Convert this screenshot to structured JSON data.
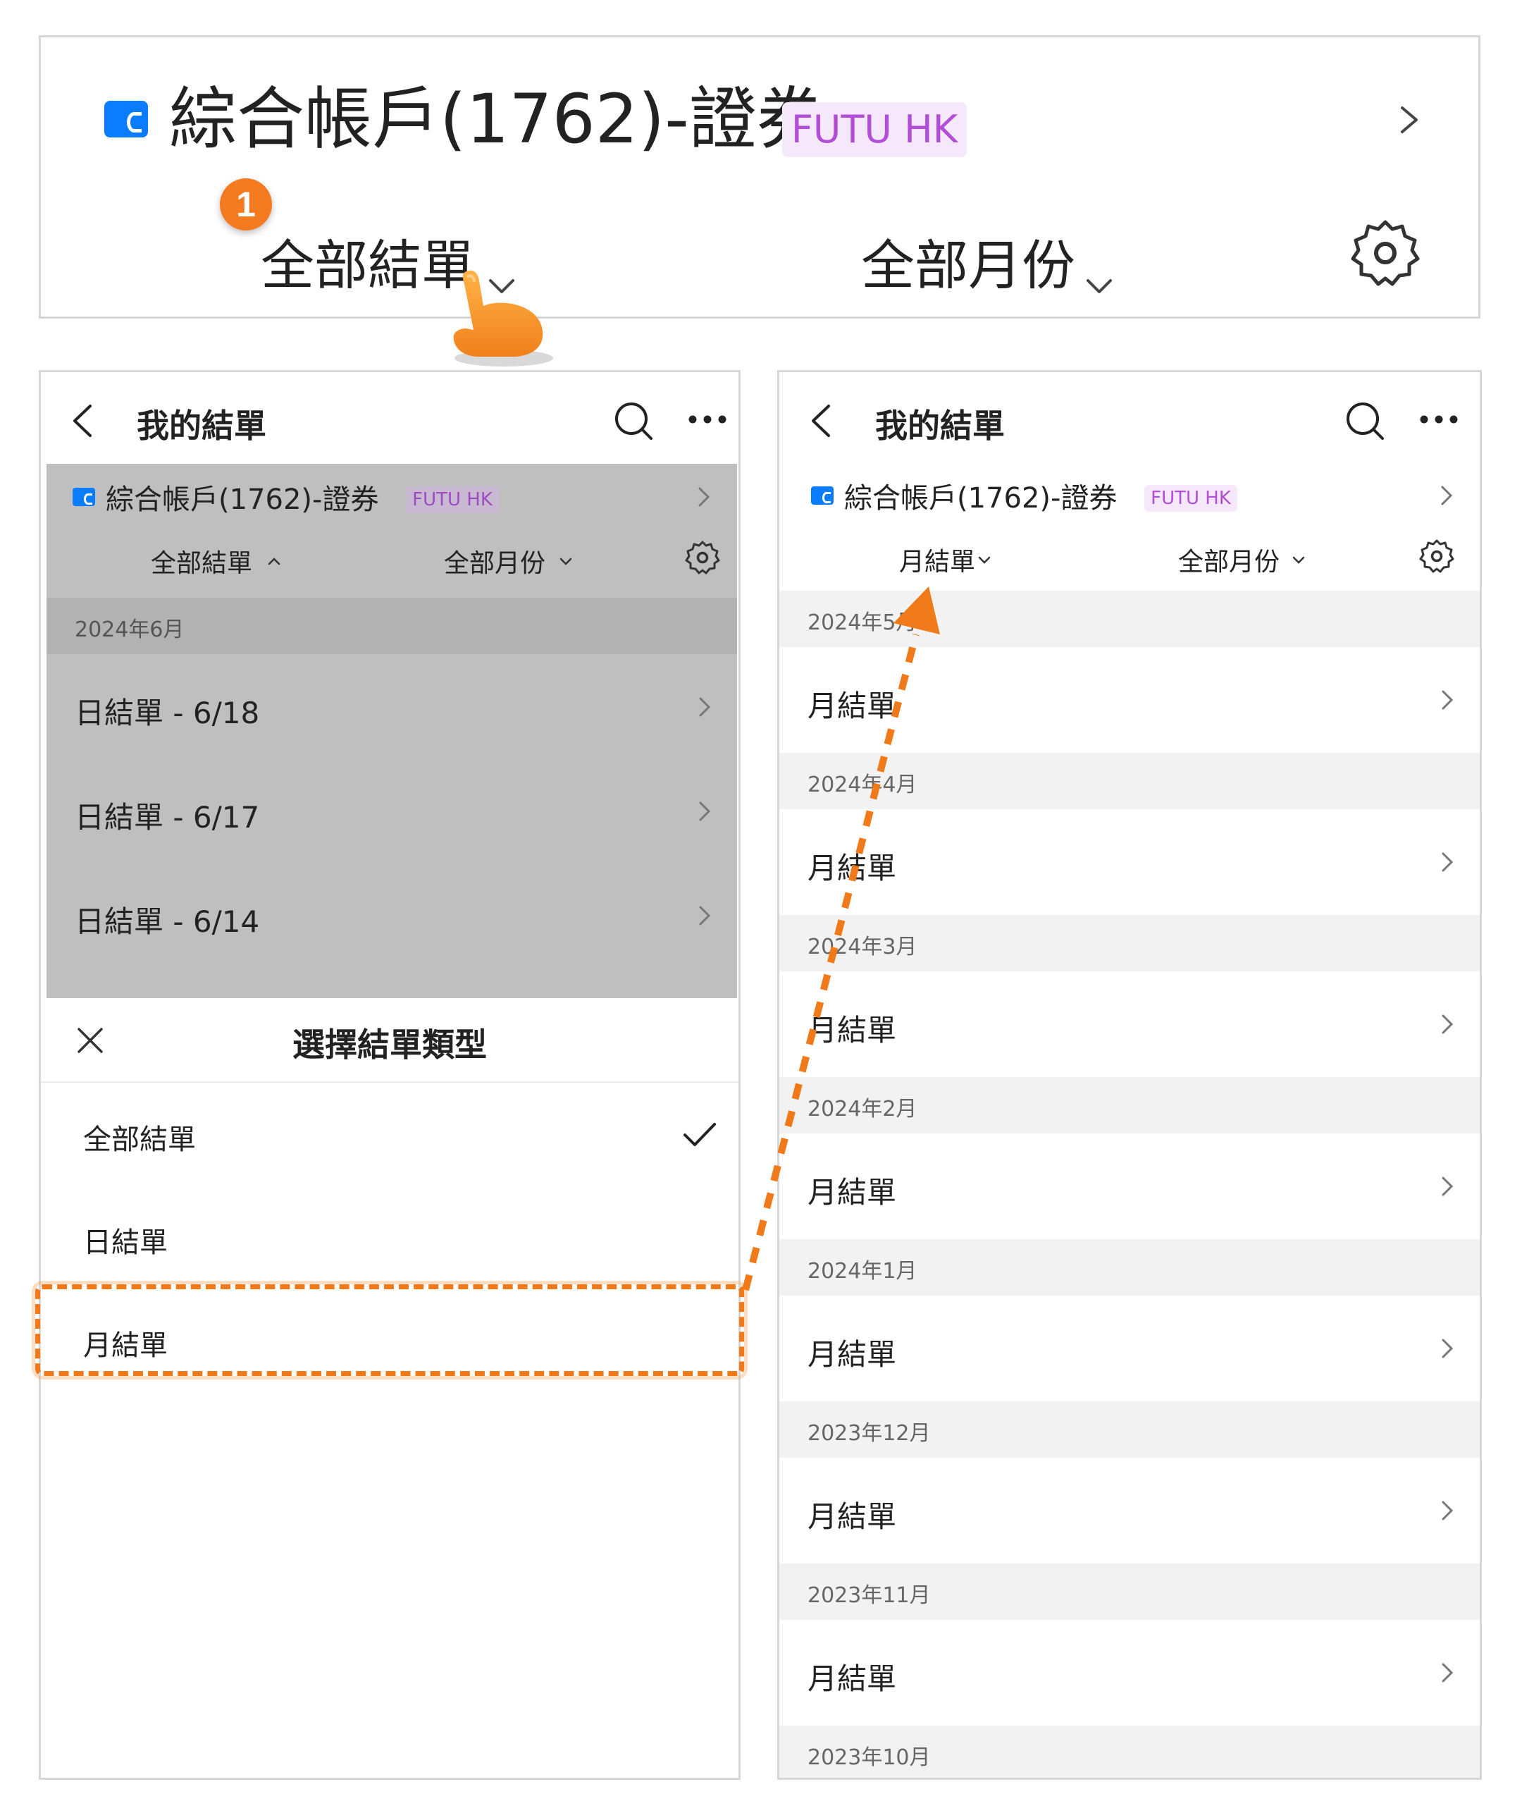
{
  "top": {
    "account": "綜合帳戶(1762)-證券",
    "badge": "FUTU HK",
    "filter_type": "全部結單",
    "filter_month": "全部月份",
    "step_number": "1"
  },
  "left_screen": {
    "nav_title": "我的結單",
    "account": "綜合帳戶(1762)-證券",
    "badge": "FUTU HK",
    "filter_type": "全部結單",
    "filter_month": "全部月份",
    "month_heading": "2024年6月",
    "statements": [
      "日結單 - 6/18",
      "日結單 - 6/17",
      "日結單 - 6/14"
    ],
    "sheet": {
      "title": "選擇結單類型",
      "options": [
        "全部結單",
        "日結單",
        "月結單"
      ],
      "selected_index": 0
    }
  },
  "right_screen": {
    "nav_title": "我的結單",
    "account": "綜合帳戶(1762)-證券",
    "badge": "FUTU HK",
    "filter_type": "月結單",
    "filter_month": "全部月份",
    "groups": [
      {
        "month": "2024年5月",
        "item": "月結單"
      },
      {
        "month": "2024年4月",
        "item": "月結單"
      },
      {
        "month": "2024年3月",
        "item": "月結單"
      },
      {
        "month": "2024年2月",
        "item": "月結單"
      },
      {
        "month": "2024年1月",
        "item": "月結單"
      },
      {
        "month": "2023年12月",
        "item": "月結單"
      },
      {
        "month": "2023年11月",
        "item": "月結單"
      }
    ],
    "last_month_heading": "2023年10月"
  },
  "colors": {
    "accent_orange": "#f07a1a",
    "wallet_blue": "#0a7cff",
    "badge_bg": "#f6e8fb",
    "badge_text": "#b14dd6"
  },
  "icons": [
    "wallet-icon",
    "chevron-right-icon",
    "chevron-down-icon",
    "gear-icon",
    "back-icon",
    "search-icon",
    "more-icon",
    "close-icon",
    "check-icon",
    "hand-pointer-icon"
  ]
}
